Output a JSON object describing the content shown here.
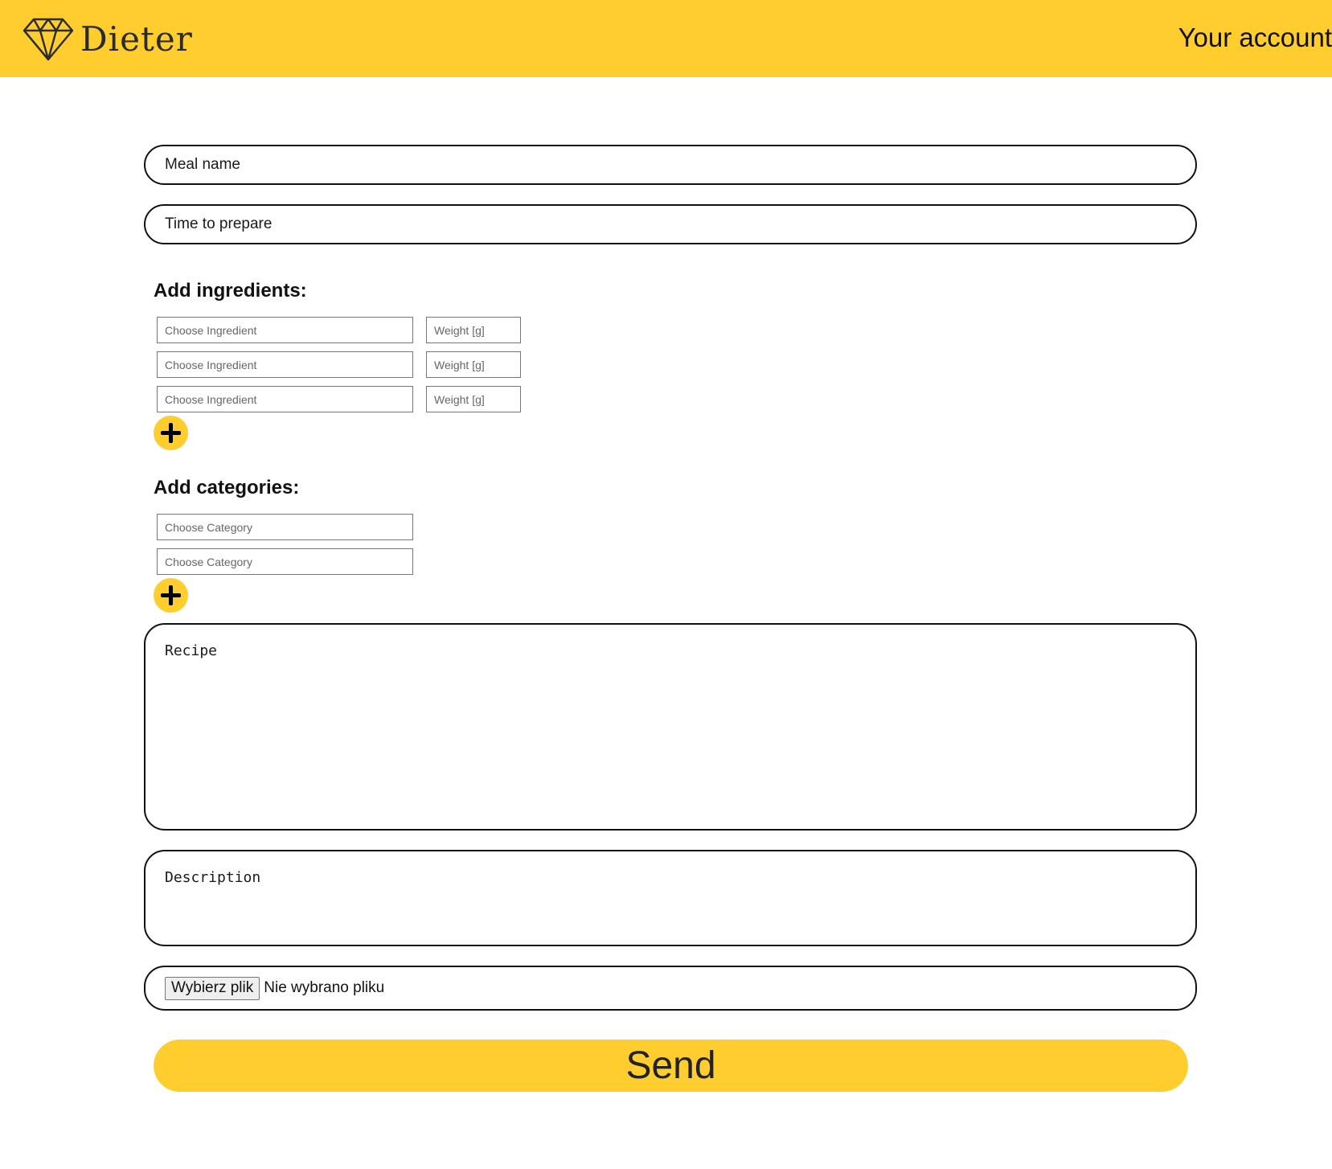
{
  "colors": {
    "brand_yellow": "#ffcd2e",
    "border": "#111111"
  },
  "header": {
    "logo_icon": "diamond-logo-icon",
    "logo_text": "Dieter",
    "account_link": "Your account"
  },
  "form": {
    "meal_name_placeholder": "Meal name",
    "time_placeholder": "Time to prepare",
    "ingredients_title": "Add ingredients:",
    "ingredient_placeholder": "Choose Ingredient",
    "weight_placeholder": "Weight [g]",
    "ingredient_rows": 3,
    "add_icon": "plus-icon",
    "categories_title": "Add categories:",
    "category_placeholder": "Choose Category",
    "category_rows": 2,
    "recipe_placeholder": "Recipe",
    "description_placeholder": "Description",
    "file_button_label": "Wybierz plik",
    "file_status": "Nie wybrano pliku",
    "send_label": "Send"
  }
}
